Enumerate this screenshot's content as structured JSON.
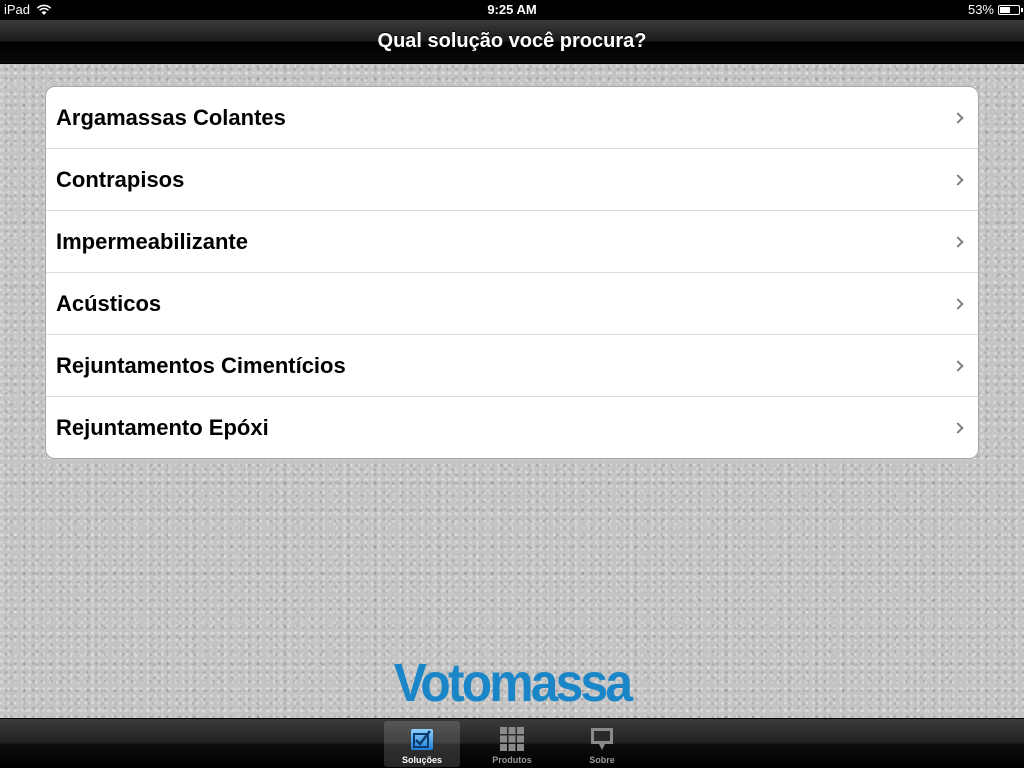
{
  "status_bar": {
    "device": "iPad",
    "time": "9:25 AM",
    "battery_percent": "53%",
    "battery_level": 0.53
  },
  "nav": {
    "title": "Qual solução você procura?"
  },
  "list": {
    "items": [
      {
        "label": "Argamassas Colantes"
      },
      {
        "label": "Contrapisos"
      },
      {
        "label": "Impermeabilizante"
      },
      {
        "label": "Acústicos"
      },
      {
        "label": "Rejuntamentos Cimentícios"
      },
      {
        "label": "Rejuntamento Epóxi"
      }
    ]
  },
  "brand": {
    "logo_text": "Votomassa",
    "color": "#1b86c7"
  },
  "tab_bar": {
    "tabs": [
      {
        "label": "Soluções",
        "icon": "checkbox-icon",
        "active": true
      },
      {
        "label": "Produtos",
        "icon": "grid-icon",
        "active": false
      },
      {
        "label": "Sobre",
        "icon": "speech-bubble-icon",
        "active": false
      }
    ]
  }
}
